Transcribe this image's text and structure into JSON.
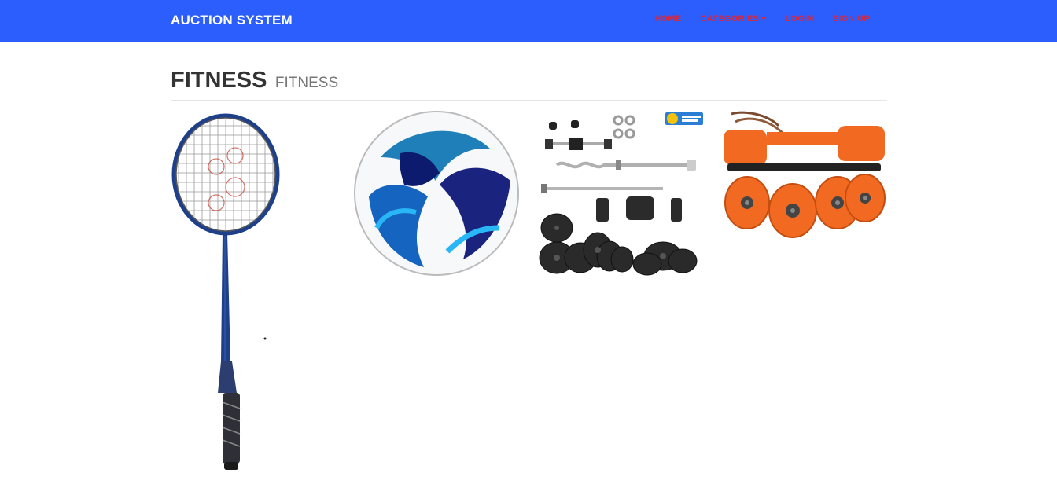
{
  "navbar": {
    "brand": "AUCTION SYSTEM",
    "links": [
      {
        "label": "HOME"
      },
      {
        "label": "CATEGORIES"
      },
      {
        "label": "LOGIN"
      },
      {
        "label": "SIGN UP"
      }
    ]
  },
  "header": {
    "title": "FITNESS",
    "subtitle": "FITNESS"
  },
  "products": [
    {
      "icon": "badminton-racket-image"
    },
    {
      "icon": "soccer-ball-image"
    },
    {
      "icon": "gym-equipment-set-image"
    },
    {
      "icon": "roller-skates-image"
    }
  ],
  "colors": {
    "navbar_bg": "#2b5efd",
    "nav_link": "#d9263a",
    "brand_text": "#ffffff"
  }
}
